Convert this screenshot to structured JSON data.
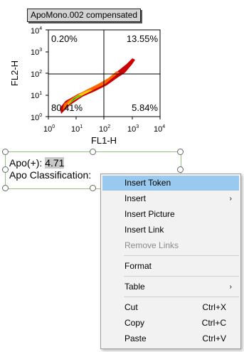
{
  "title_badge": "ApoMono.002 compensated",
  "plot": {
    "y_axis_label": "FL2-H",
    "x_axis_label": "FL1-H",
    "x_ticks": [
      {
        "base": "10",
        "exp": "0"
      },
      {
        "base": "10",
        "exp": "1"
      },
      {
        "base": "10",
        "exp": "2"
      },
      {
        "base": "10",
        "exp": "3"
      },
      {
        "base": "10",
        "exp": "4"
      }
    ],
    "y_ticks": [
      {
        "base": "10",
        "exp": "0"
      },
      {
        "base": "10",
        "exp": "1"
      },
      {
        "base": "10",
        "exp": "2"
      },
      {
        "base": "10",
        "exp": "3"
      },
      {
        "base": "10",
        "exp": "4"
      }
    ],
    "quadrants": {
      "upper_left": "0.20%",
      "upper_right": "13.55%",
      "lower_left": "80.41%",
      "lower_right": "5.84%"
    },
    "density_colors": [
      "#cc0000",
      "#ff6600",
      "#ffcc00",
      "#66cc00",
      "#00aa44"
    ]
  },
  "textbox": {
    "apo_label": "Apo(+): ",
    "apo_value": "4.71",
    "classification_label": "Apo Classification:"
  },
  "context_menu": {
    "items": [
      {
        "label": "Insert Token",
        "shortcut": "",
        "submenu": false,
        "disabled": false,
        "highlighted": true
      },
      {
        "label": "Insert",
        "shortcut": "",
        "submenu": true,
        "disabled": false,
        "highlighted": false
      },
      {
        "label": "Insert Picture",
        "shortcut": "",
        "submenu": false,
        "disabled": false,
        "highlighted": false
      },
      {
        "label": "Insert Link",
        "shortcut": "",
        "submenu": false,
        "disabled": false,
        "highlighted": false
      },
      {
        "label": "Remove Links",
        "shortcut": "",
        "submenu": false,
        "disabled": true,
        "highlighted": false
      },
      {
        "label": "Format",
        "shortcut": "",
        "submenu": false,
        "disabled": false,
        "highlighted": false
      },
      {
        "label": "Table",
        "shortcut": "",
        "submenu": true,
        "disabled": false,
        "highlighted": false
      },
      {
        "label": "Cut",
        "shortcut": "Ctrl+X",
        "submenu": false,
        "disabled": false,
        "highlighted": false
      },
      {
        "label": "Copy",
        "shortcut": "Ctrl+C",
        "submenu": false,
        "disabled": false,
        "highlighted": false
      },
      {
        "label": "Paste",
        "shortcut": "Ctrl+V",
        "submenu": false,
        "disabled": false,
        "highlighted": false
      }
    ],
    "submenu_arrow": "›"
  }
}
